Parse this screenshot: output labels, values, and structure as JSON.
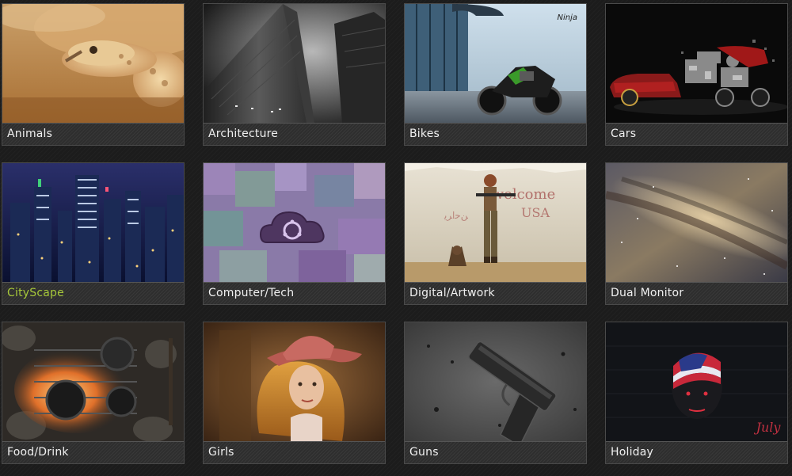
{
  "accent_color": "#a6c73a",
  "categories": [
    {
      "label": "Animals",
      "thumb": "rattlesnake-in-sand"
    },
    {
      "label": "Architecture",
      "thumb": "skyscrapers-bw"
    },
    {
      "label": "Bikes",
      "thumb": "ninja-motorcycle"
    },
    {
      "label": "Cars",
      "thumb": "exploded-race-car"
    },
    {
      "label": "CityScape",
      "thumb": "city-at-night",
      "active": true
    },
    {
      "label": "Computer/Tech",
      "thumb": "ubuntu-cloud"
    },
    {
      "label": "Digital/Artwork",
      "thumb": "soldier-with-dog"
    },
    {
      "label": "Dual Monitor",
      "thumb": "galaxy"
    },
    {
      "label": "Food/Drink",
      "thumb": "campfire-cooking"
    },
    {
      "label": "Girls",
      "thumb": "woman-in-hat"
    },
    {
      "label": "Guns",
      "thumb": "handgun"
    },
    {
      "label": "Holiday",
      "thumb": "july-4th-face"
    }
  ]
}
